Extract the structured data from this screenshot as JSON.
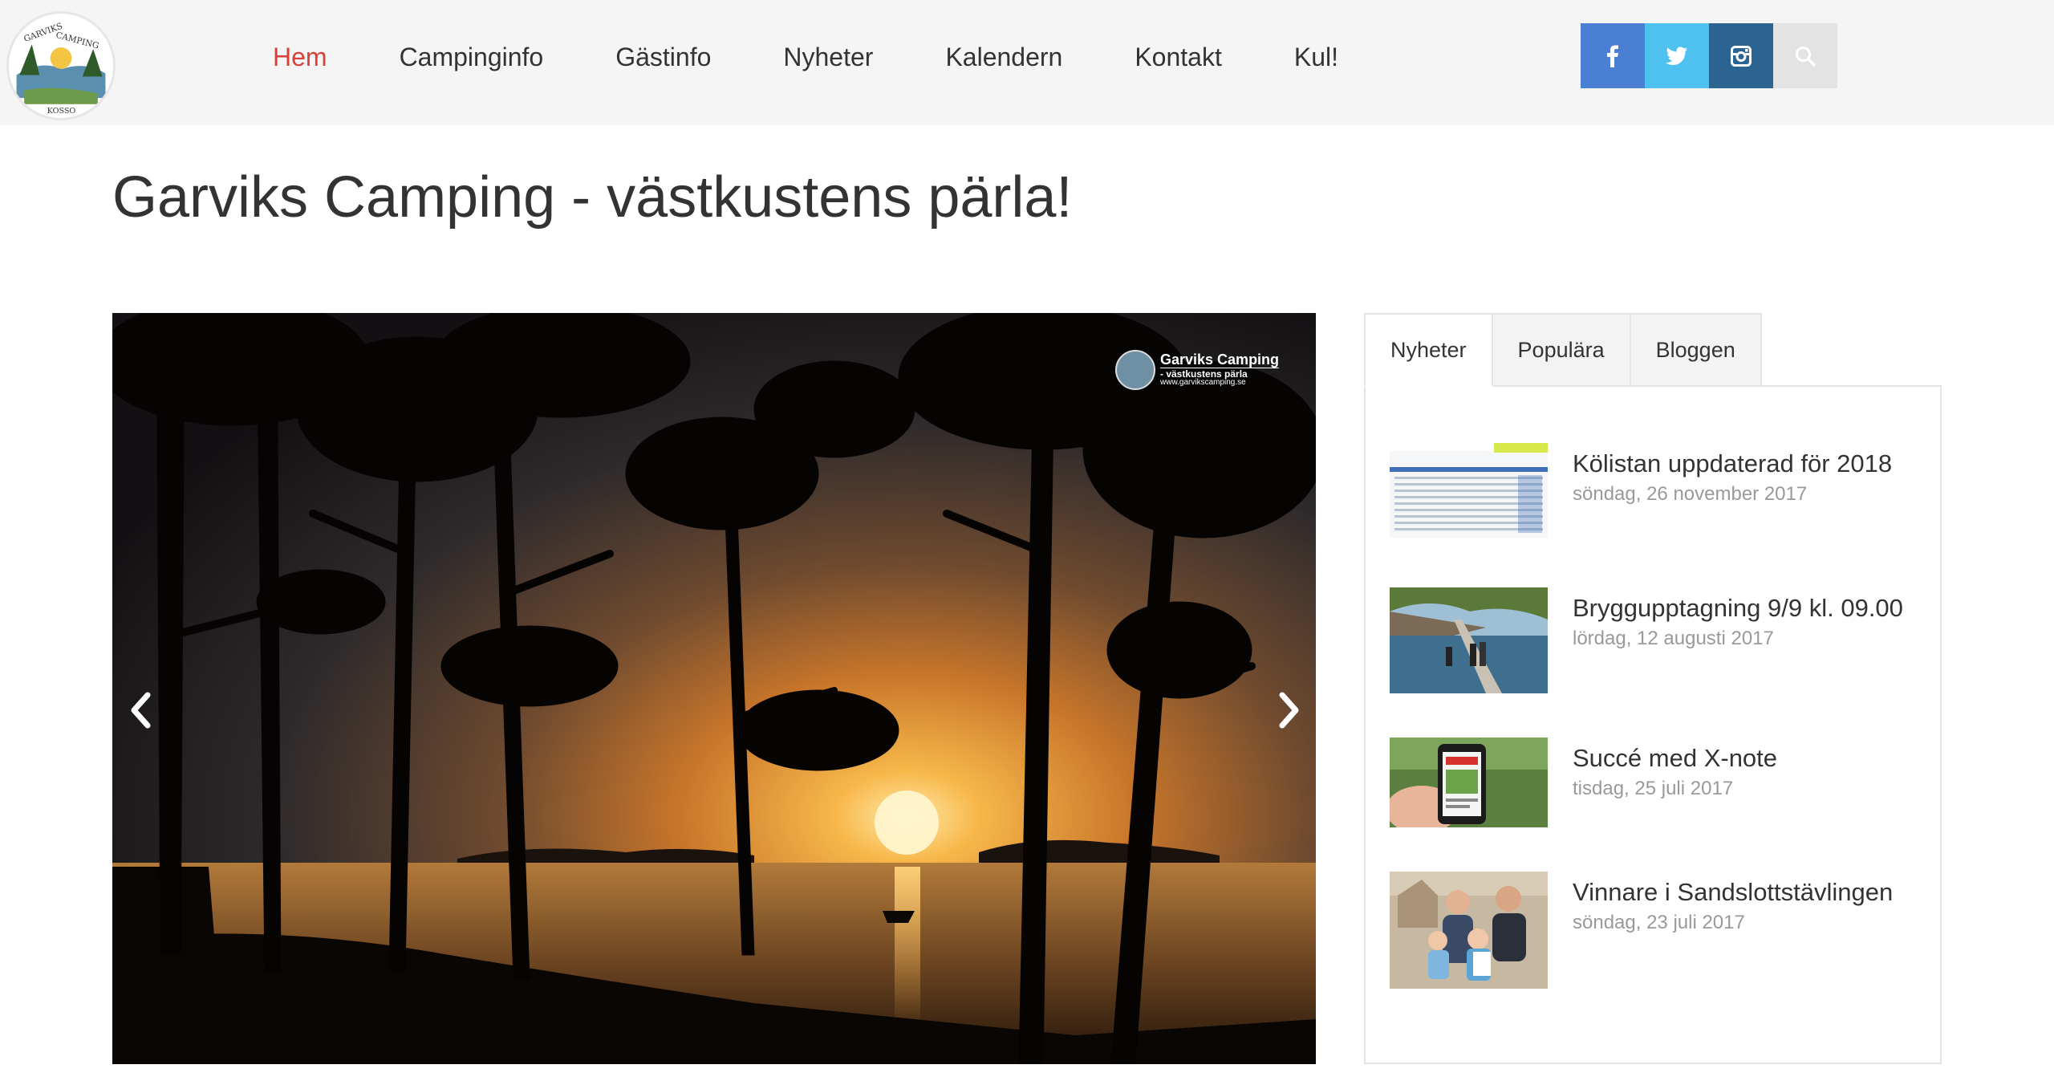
{
  "header": {
    "nav": [
      "Hem",
      "Campinginfo",
      "Gästinfo",
      "Nyheter",
      "Kalendern",
      "Kontakt",
      "Kul!"
    ],
    "active_nav": "Hem",
    "social": [
      "facebook-icon",
      "twitter-icon",
      "instagram-icon",
      "search-icon"
    ],
    "colors": {
      "facebook": "#4a7fd4",
      "twitter": "#4ec1f1",
      "instagram": "#2b6391",
      "search": "#e3e3e3",
      "active": "#d9403a"
    }
  },
  "page": {
    "title": "Garviks Camping - västkustens pärla!"
  },
  "slider": {
    "watermark_title": "Garviks Camping",
    "watermark_sub": "- västkustens pärla",
    "watermark_url": "www.garvikscamping.se"
  },
  "tabs": {
    "labels": [
      "Nyheter",
      "Populära",
      "Bloggen"
    ],
    "active": "Nyheter"
  },
  "news": [
    {
      "title": "Kölistan uppdaterad för 2018",
      "date": "söndag, 26 november 2017"
    },
    {
      "title": "Brygguppt agning 9/9 kl. 09.00",
      "date": "lördag, 12 augusti 2017"
    },
    {
      "title": "Succé med X-note",
      "date": "tisdag, 25 juli 2017"
    },
    {
      "title": "Vinnare i Sandslottstävlingen",
      "date": "söndag, 23 juli 2017"
    }
  ]
}
